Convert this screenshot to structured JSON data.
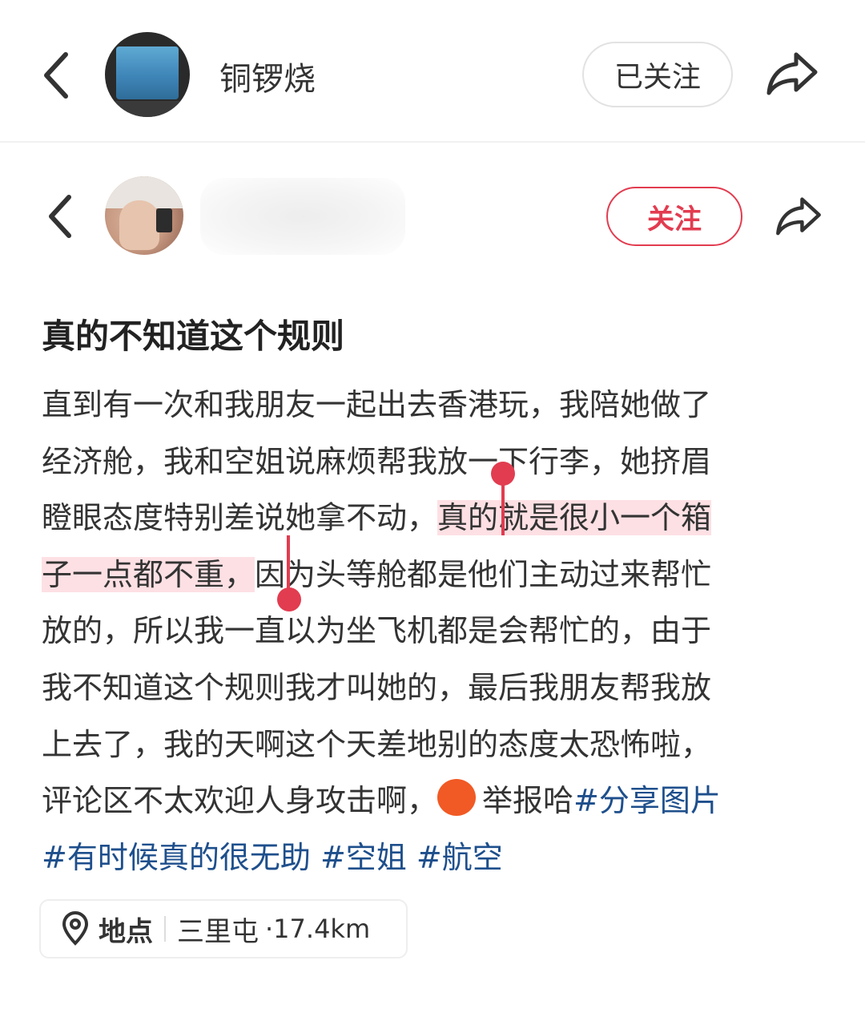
{
  "outer_post": {
    "author_name": "铜锣烧",
    "follow_status": "已关注"
  },
  "inner_post": {
    "follow_label": "关注",
    "title": "真的不知道这个规则",
    "body": {
      "l1": "直到有一次和我朋友一起出去香港玩，我陪她做了",
      "l2": "经济舱，我和空姐说麻烦帮我放一下行李，她挤眉",
      "l3_a": "瞪眼态度特别差说她拿不动，",
      "l3_b": "真的就是很小一个箱",
      "l4_a": "子一点都不重，",
      "l4_b": "因为头等舱都是他们主动过来帮忙",
      "l5": "放的，所以我一直以为坐飞机都是会帮忙的，由于",
      "l6": "我不知道这个规则我才叫她的，最后我朋友帮我放",
      "l7": "上去了，我的天啊这个天差地别的态度太恐怖啦，",
      "l8_a": "评论区不太欢迎人身攻击啊，",
      "l8_emoji_text": "&$!#%",
      "l8_b": "举报哈",
      "tag1": "#分享图片",
      "tag2": "#有时候真的很无助",
      "tag3": "#空姐",
      "tag4": "#航空"
    },
    "location": {
      "label": "地点",
      "place": "三里屯",
      "distance": "·17.4km"
    }
  },
  "colors": {
    "accent": "#e23c50",
    "highlight": "#fde0e4",
    "hashtag": "#1e4f8c"
  }
}
